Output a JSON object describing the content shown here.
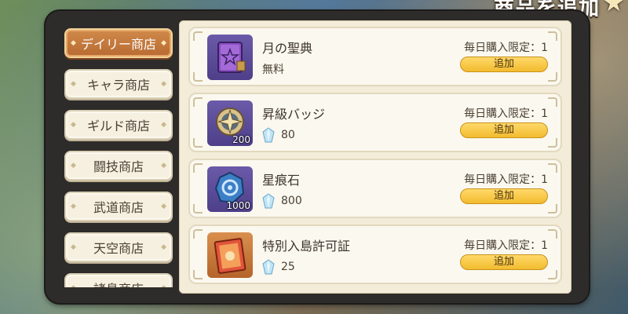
{
  "header": {
    "title": "商品を追加",
    "icon": "star-icon"
  },
  "sidebar": {
    "tabs": [
      {
        "label": "デイリー商店",
        "active": true
      },
      {
        "label": "キャラ商店",
        "active": false
      },
      {
        "label": "ギルド商店",
        "active": false
      },
      {
        "label": "闘技商店",
        "active": false
      },
      {
        "label": "武道商店",
        "active": false
      },
      {
        "label": "天空商店",
        "active": false
      },
      {
        "label": "諸島商店",
        "active": false
      }
    ]
  },
  "items": [
    {
      "name": "月の聖典",
      "price": "無料",
      "currency": "",
      "quantity": "",
      "limit": "毎日購入限定：1",
      "button": "追加",
      "icon": "book-icon"
    },
    {
      "name": "昇級バッジ",
      "price": "80",
      "currency": "gem-icon",
      "quantity": "200",
      "limit": "毎日購入限定：1",
      "button": "追加",
      "icon": "badge-icon"
    },
    {
      "name": "星痕石",
      "price": "800",
      "currency": "gem-icon",
      "quantity": "1000",
      "limit": "毎日購入限定：1",
      "button": "追加",
      "icon": "stone-icon"
    },
    {
      "name": "特別入島許可証",
      "price": "25",
      "currency": "gem-icon",
      "quantity": "",
      "limit": "毎日購入限定：1",
      "button": "追加",
      "icon": "pass-icon"
    }
  ],
  "colors": {
    "accent": "#f2bb2e",
    "active_tab": "#c27a3c",
    "panel": "#f3ecd9"
  }
}
